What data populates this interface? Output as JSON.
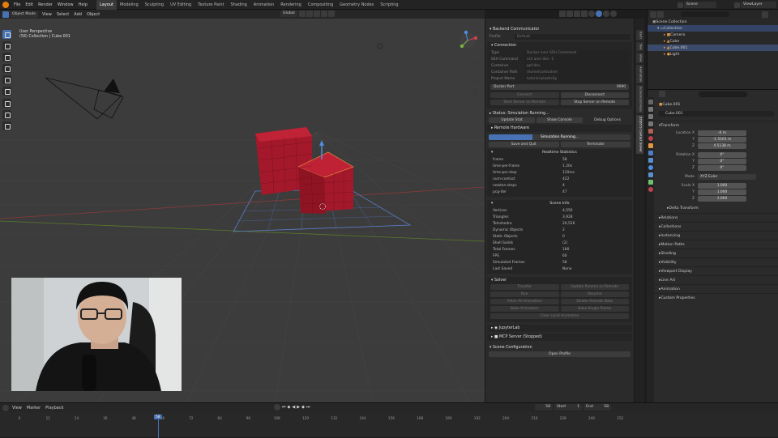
{
  "topbar": {
    "menus": [
      "File",
      "Edit",
      "Render",
      "Window",
      "Help"
    ],
    "workspaces": [
      "Layout",
      "Modeling",
      "Sculpting",
      "UV Editing",
      "Texture Paint",
      "Shading",
      "Animation",
      "Rendering",
      "Compositing",
      "Geometry Nodes",
      "Scripting"
    ],
    "active_workspace": "Layout",
    "scene": "Scene",
    "view_layer": "ViewLayer"
  },
  "viewport_header": {
    "mode": "Object Mode",
    "menus": [
      "View",
      "Select",
      "Add",
      "Object"
    ],
    "orientation": "Global",
    "options": "Options"
  },
  "viewport": {
    "view_name": "User Perspective",
    "collection_info": "(58) Collection | Cube.001"
  },
  "panel": {
    "title": "Backend Communicator",
    "profile_label": "Profile",
    "profile_value": "Default",
    "connection": {
      "header": "Connection",
      "fields": [
        {
          "label": "Type",
          "value": "Docker over SSH Command"
        },
        {
          "label": "SSH Command",
          "value": "ssh asrc-dev -1"
        },
        {
          "label": "Container",
          "value": "ppf-dev"
        },
        {
          "label": "Container Path",
          "value": "/home/contsolver"
        },
        {
          "label": "Project Name",
          "value": "tutorial-plasticity"
        }
      ],
      "docker_port_label": "Docker Port",
      "docker_port_value": "9090",
      "connect": "Connect",
      "disconnect": "Disconnect",
      "start_server": "Start Server on Remote",
      "stop_server": "Stop Server on Remote"
    },
    "status": {
      "header": "Status: Simulation Running...",
      "update_status": "Update Stat",
      "show_console": "Show Console",
      "debug_options": "Debug Options"
    },
    "remote_hardware": "Remote Hardware",
    "progress_label": "Simulation Running...",
    "progress": 0.31,
    "save_and_quit": "Save and Quit",
    "terminate": "Terminate",
    "realtime": {
      "header": "Realtime Statistics",
      "rows": [
        {
          "k": "frame",
          "v": "58"
        },
        {
          "k": "time-per-frame",
          "v": "1.20s"
        },
        {
          "k": "time-per-step",
          "v": "120ms"
        },
        {
          "k": "num-contact",
          "v": "422"
        },
        {
          "k": "newton-steps",
          "v": "4"
        },
        {
          "k": "pcg-iter",
          "v": "47"
        }
      ]
    },
    "scene_info": {
      "header": "Scene Info",
      "rows": [
        {
          "k": "Vertices",
          "v": "4,556"
        },
        {
          "k": "Triangles",
          "v": "3,928"
        },
        {
          "k": "Tetrahedra",
          "v": "20,526"
        },
        {
          "k": "Dynamic Objects",
          "v": "2"
        },
        {
          "k": "Static Objects",
          "v": "0"
        },
        {
          "k": "Shell Solids",
          "v": "(2)"
        },
        {
          "k": "Total Frames",
          "v": "180"
        },
        {
          "k": "FPS",
          "v": "60"
        },
        {
          "k": "Simulated Frames",
          "v": "58"
        },
        {
          "k": "Last Saved",
          "v": "None"
        }
      ]
    },
    "solver": {
      "header": "Solver",
      "buttons": [
        [
          "Transfer",
          "Update Params on Remote"
        ],
        [
          "Run",
          "Resume"
        ],
        [
          "Fetch All Animation",
          "Delete Remote Data"
        ],
        [
          "Bake Animation",
          "Bake Single Frame"
        ]
      ],
      "clear": "Clear Local Animation"
    },
    "jupyterlab": "JupyterLab",
    "mcp_server": "MCP Server (Stopped)",
    "scene_config": "Scene Configuration",
    "open_profile": "Open Profile"
  },
  "panel_tabs": [
    "Item",
    "Tool",
    "View",
    "Animation",
    "Screencast Keys",
    "ZOZO'S Contact Solver"
  ],
  "outliner": {
    "search_placeholder": "",
    "scene_collection": "Scene Collection",
    "collection": "Collection",
    "items": [
      "Camera",
      "Cube",
      "Cube.001",
      "Light"
    ]
  },
  "properties": {
    "object_name": "Cube.001",
    "object_field": "Cube.001",
    "transform_header": "Transform",
    "location": [
      {
        "k": "Location X",
        "v": "-0 m"
      },
      {
        "k": "Y",
        "v": "-1.5161 m"
      },
      {
        "k": "Z",
        "v": "4.5138 m"
      }
    ],
    "rotation": [
      {
        "k": "Rotation X",
        "v": "0°"
      },
      {
        "k": "Y",
        "v": "0°"
      },
      {
        "k": "Z",
        "v": "0°"
      }
    ],
    "mode_label": "Mode",
    "mode_value": "XYZ Euler",
    "scale": [
      {
        "k": "Scale X",
        "v": "1.000"
      },
      {
        "k": "Y",
        "v": "1.000"
      },
      {
        "k": "Z",
        "v": "1.000"
      }
    ],
    "delta": "Delta Transform",
    "sections": [
      "Relations",
      "Collections",
      "Instancing",
      "Motion Paths",
      "Shading",
      "Visibility",
      "Viewport Display",
      "Line Art",
      "Animation",
      "Custom Properties"
    ]
  },
  "timeline": {
    "menus": [
      "View",
      "Marker",
      "Playback"
    ],
    "current_frame": "58",
    "start_label": "Start",
    "start": "1",
    "end_label": "End",
    "end": "58",
    "ticks": [
      "0",
      "12",
      "24",
      "36",
      "48",
      "60",
      "72",
      "84",
      "96",
      "108",
      "120",
      "132",
      "144",
      "156",
      "168",
      "180",
      "192",
      "204",
      "216",
      "228",
      "240",
      "252"
    ]
  },
  "colors": {
    "accent": "#4772b3",
    "cube": "#a3192b",
    "viewport_bg": "#3c3c3c"
  }
}
